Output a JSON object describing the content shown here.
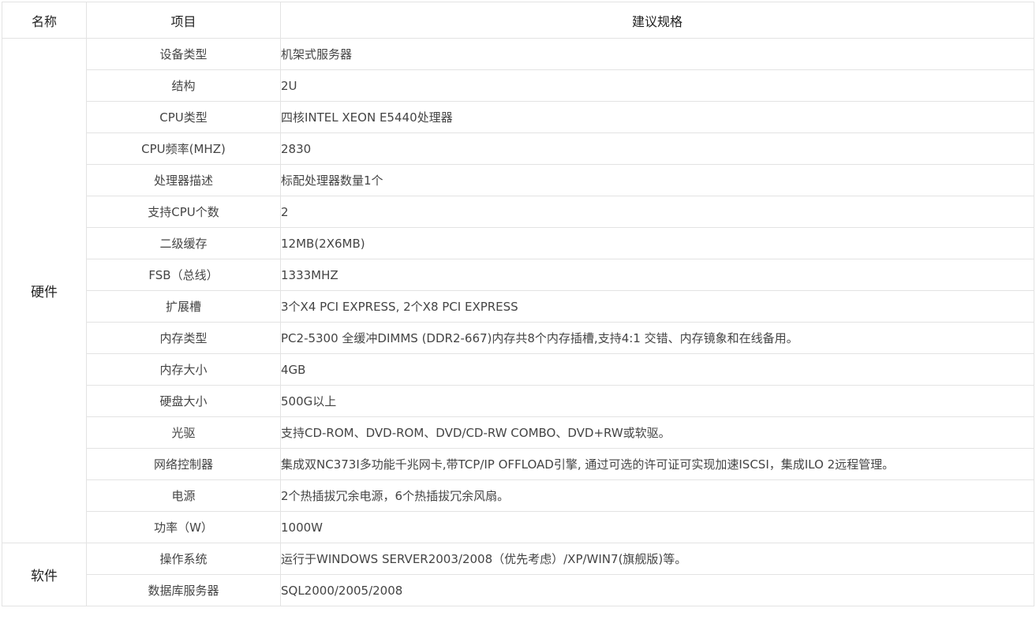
{
  "header": {
    "col_name": "名称",
    "col_item": "项目",
    "col_spec": "建议规格"
  },
  "groups": [
    {
      "name": "硬件",
      "rows": [
        {
          "item": "设备类型",
          "spec": "机架式服务器"
        },
        {
          "item": "结构",
          "spec": "2U"
        },
        {
          "item": "CPU类型",
          "spec": "四核INTEL XEON E5440处理器"
        },
        {
          "item": "CPU频率(MHZ)",
          "spec": "2830"
        },
        {
          "item": "处理器描述",
          "spec": "标配处理器数量1个"
        },
        {
          "item": "支持CPU个数",
          "spec": "2"
        },
        {
          "item": "二级缓存",
          "spec": "12MB(2X6MB)"
        },
        {
          "item": "FSB（总线）",
          "spec": "1333MHZ"
        },
        {
          "item": "扩展槽",
          "spec": "3个X4 PCI EXPRESS, 2个X8 PCI EXPRESS"
        },
        {
          "item": "内存类型",
          "spec": "PC2-5300 全缓冲DIMMS (DDR2-667)内存共8个内存插槽,支持4:1 交错、内存镜象和在线备用。"
        },
        {
          "item": "内存大小",
          "spec": "4GB"
        },
        {
          "item": "硬盘大小",
          "spec": "500G以上"
        },
        {
          "item": "光驱",
          "spec": "支持CD-ROM、DVD-ROM、DVD/CD-RW COMBO、DVD+RW或软驱。"
        },
        {
          "item": "网络控制器",
          "spec": "集成双NC373I多功能千兆网卡,带TCP/IP OFFLOAD引擎, 通过可选的许可证可实现加速ISCSI，集成ILO 2远程管理。"
        },
        {
          "item": "电源",
          "spec": "2个热插拔冗余电源，6个热插拔冗余风扇。"
        },
        {
          "item": "功率（W）",
          "spec": "1000W"
        }
      ]
    },
    {
      "name": "软件",
      "rows": [
        {
          "item": "操作系统",
          "spec": "运行于WINDOWS SERVER2003/2008（优先考虑）/XP/WIN7(旗舰版)等。"
        },
        {
          "item": "数据库服务器",
          "spec": "SQL2000/2005/2008"
        }
      ]
    }
  ]
}
